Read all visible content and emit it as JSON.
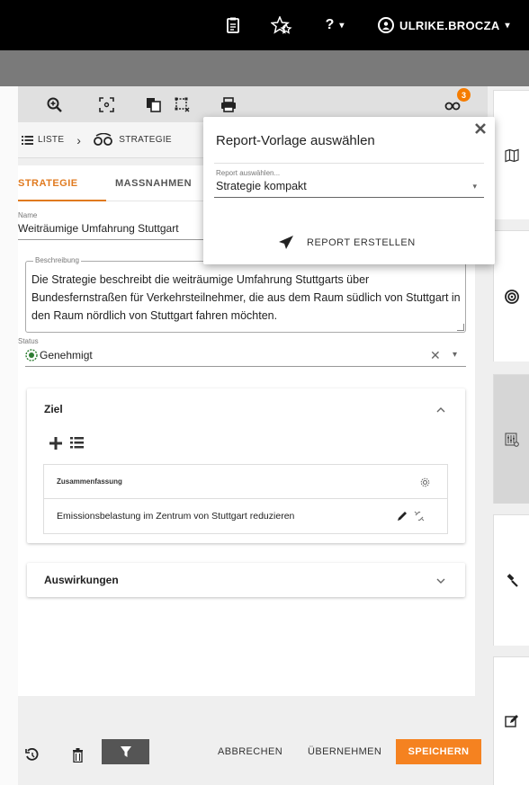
{
  "topbar": {
    "user_name": "ULRIKE.BROCZA",
    "help_label": "?",
    "user_dropdown": "▾",
    "help_dropdown": "▾"
  },
  "toolbar": {
    "notification_count": "3"
  },
  "breadcrumb": {
    "list_label": "LISTE",
    "separator": "›",
    "current_label": "STRATEGIE"
  },
  "tabs": [
    {
      "label": "STRATEGIE"
    },
    {
      "label": "MASSNAHMEN"
    }
  ],
  "form": {
    "name_label": "Name",
    "name_value": "Weiträumige Umfahrung Stuttgart",
    "description_label": "Beschreibung",
    "description_value": "Die Strategie beschreibt die weiträumige Umfahrung Stuttgarts über Bundesfernstraßen für Verkehrsteilnehmer, die aus dem Raum südlich von Stuttgart in den Raum nördlich von Stuttgart fahren möchten.",
    "status_label": "Status",
    "status_value": "Genehmigt",
    "status_clear": "✕",
    "status_caret": "▾"
  },
  "ziel_section": {
    "title": "Ziel",
    "table_header": "Zusammenfassung",
    "rows": [
      {
        "text": "Emissionsbelastung im Zentrum von Stuttgart reduzieren"
      }
    ]
  },
  "auswirkungen_section": {
    "title": "Auswirkungen"
  },
  "footer": {
    "cancel_label": "ABBRECHEN",
    "apply_label": "ÜBERNEHMEN",
    "save_label": "SPEICHERN"
  },
  "popup": {
    "title": "Report-Vorlage auswählen",
    "select_label": "Report auswählen...",
    "select_value": "Strategie kompakt",
    "action_label": "REPORT ERSTELLEN"
  },
  "colors": {
    "accent": "#f58220",
    "tab_active": "#e07a1f",
    "status_green": "#2e7d32"
  },
  "icons": {
    "topbar": [
      "clipboard-icon",
      "star-icon",
      "help-icon",
      "user-avatar-icon"
    ],
    "toolbar": [
      "zoom-in-icon",
      "fit-screen-icon",
      "copy-icon",
      "select-area-icon",
      "print-icon",
      "notification-icon"
    ],
    "sidebar": [
      "map-icon",
      "target-icon",
      "equalizer-icon",
      "gavel-icon",
      "edit-icon"
    ]
  }
}
